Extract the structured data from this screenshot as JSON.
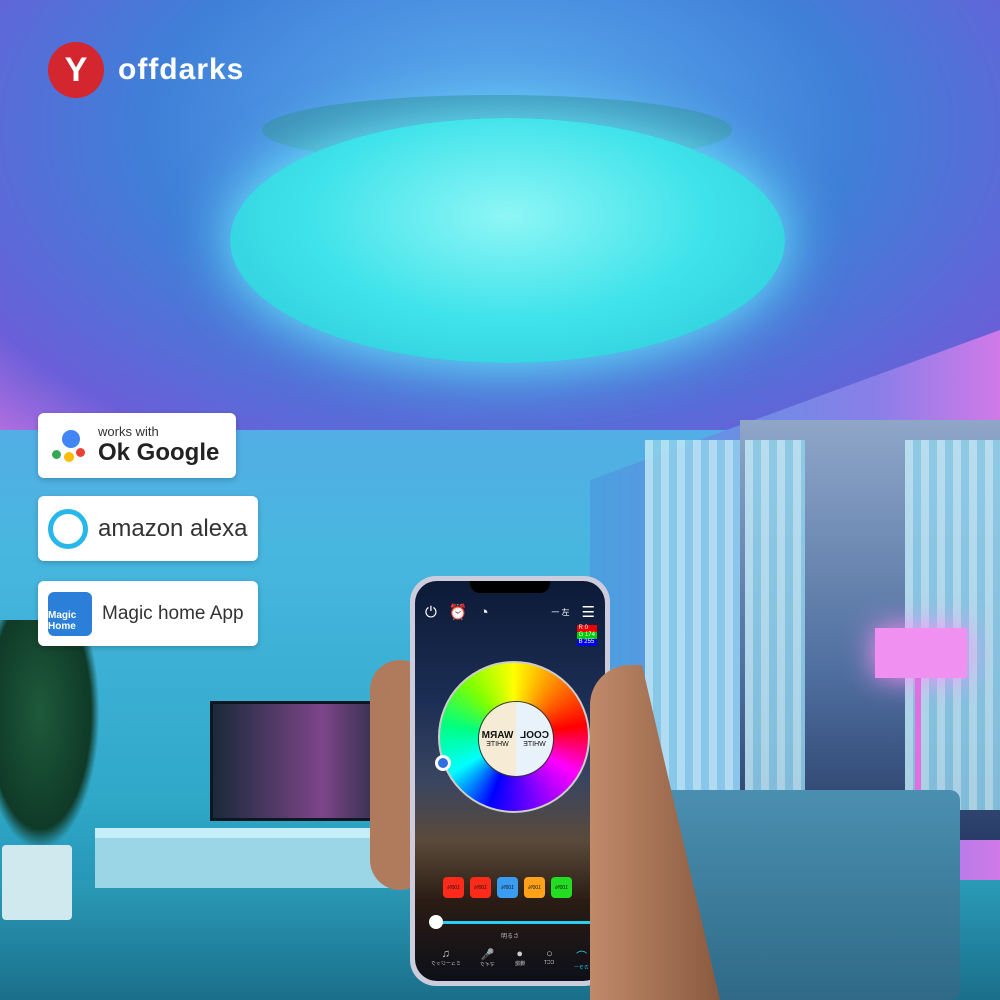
{
  "brand": {
    "logo_mark": "Y",
    "name": "offdarks"
  },
  "badges": {
    "google": {
      "small": "works with",
      "big": "Ok Google"
    },
    "alexa": {
      "label": "amazon alexa"
    },
    "magic": {
      "icon_text": "Magic Home",
      "label": "Magic home App"
    }
  },
  "phone": {
    "top_icons": [
      "power-icon",
      "alarm-icon",
      "timer-icon"
    ],
    "top_right": "一 左",
    "rgb": {
      "r": "R 0",
      "g": "G 174",
      "b": "B 255"
    },
    "cool": {
      "title": "COOL",
      "sub": "WHITE"
    },
    "warm": {
      "title": "WARM",
      "sub": "WHITE"
    },
    "chips": [
      {
        "label": "100%",
        "color": "#ff2a1a"
      },
      {
        "label": "100%",
        "color": "#ff2a1a"
      },
      {
        "label": "100%",
        "color": "#3a9cf0"
      },
      {
        "label": "100%",
        "color": "#ffa21a"
      },
      {
        "label": "100%",
        "color": "#22dd22"
      }
    ],
    "brightness_label": "明るさ",
    "brightness_percent": 0,
    "nav": [
      {
        "icon": "♫",
        "label": "ミュージック"
      },
      {
        "icon": "🎤",
        "label": "マイク"
      },
      {
        "icon": "●",
        "label": "機能"
      },
      {
        "icon": "○",
        "label": "CCT"
      },
      {
        "icon": "⌒",
        "label": "カラー"
      }
    ]
  }
}
